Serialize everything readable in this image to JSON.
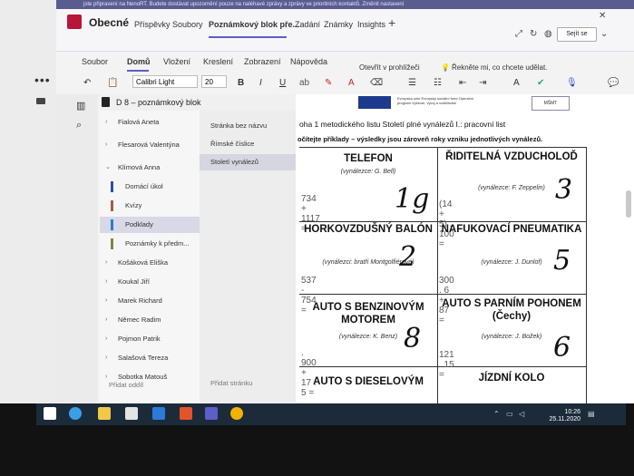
{
  "notice": "jste připravení na NenoRT. Budete dostávat upozornění pouze na naléhavé zprávy a zprávy ve prioritních kontaktů. Změnit nastavení",
  "teams": {
    "channel": "Obecné",
    "tabs": [
      "Příspěvky",
      "Soubory",
      "Poznámkový blok pře...",
      "Zadání",
      "Známky",
      "Insights"
    ],
    "plus": "+",
    "share_label": "Sejít se"
  },
  "ribbon": {
    "tabs": [
      "Soubor",
      "Domů",
      "Vložení",
      "Kreslení",
      "Zobrazení",
      "Nápověda"
    ],
    "open_browser": "Otevřít v prohlížeči",
    "tell_me": "Řekněte mi, co chcete udělat.",
    "font": "Calibri Light",
    "size": "20",
    "bold": "B",
    "italic": "I",
    "underline": "U"
  },
  "notebook": {
    "title": "D 8 – poznámkový blok",
    "sections": [
      {
        "label": "Fialová Aneta",
        "type": "group"
      },
      {
        "label": "Flesarová Valentýna",
        "type": "group"
      },
      {
        "label": "Klímová Anna",
        "type": "group-open"
      },
      {
        "label": "Domácí úkol",
        "type": "sub",
        "color": "#2b4ea8"
      },
      {
        "label": "Kvízy",
        "type": "sub",
        "color": "#a65a4a"
      },
      {
        "label": "Podklady",
        "type": "sub-selected",
        "color": "#2b7bd6"
      },
      {
        "label": "Poznámky k předm...",
        "type": "sub",
        "color": "#7a8a3a"
      },
      {
        "label": "Košáková Eliška",
        "type": "group"
      },
      {
        "label": "Koukal Jiří",
        "type": "group"
      },
      {
        "label": "Marek Richard",
        "type": "group"
      },
      {
        "label": "Němec Radim",
        "type": "group"
      },
      {
        "label": "Pojmon Patrik",
        "type": "group"
      },
      {
        "label": "Salašová Tereza",
        "type": "group"
      },
      {
        "label": "Sobotka Matouš",
        "type": "group"
      }
    ],
    "pages": [
      {
        "label": "Stránka bez názvu",
        "selected": false
      },
      {
        "label": "Římské číslice",
        "selected": false
      },
      {
        "label": "Století vynálezů",
        "selected": true
      }
    ],
    "add_section": "Přidat oddíl",
    "add_page": "Přidat stránku"
  },
  "page": {
    "eu_text": "Evropská unie Evropský sociální fond Operační program Výzkum, vývoj a vzdělávání",
    "msmt": "MŠMT",
    "heading": "oha 1 metodického listu Století plné vynálezů I.: pracovní list",
    "instruction": "očítejte příklady – výsledky jsou zároveň roky vzniku jednotlivých vynálezů.",
    "cells": [
      {
        "title": "TELEFON",
        "inventor": "(vynálezce: G. Bell)",
        "example": "734 + 1117 =",
        "answer": "1g"
      },
      {
        "title": "ŘIDITELNÁ VZDUCHOLOĎ",
        "inventor": "(vynálezce: F. Zeppelin)",
        "example": "(14 + 5) . 100 =",
        "answer": "3"
      },
      {
        "title": "HORKOVZDUŠNÝ BALÓN",
        "inventor": "(vynálezci: bratři Montgolfiérové)",
        "example": "537 - 754 =",
        "answer": "2"
      },
      {
        "title": "NAFUKOVACÍ PNEUMATIKA",
        "inventor": "(vynálezce: J. Dunlof)",
        "example": "300 . 6 + 87 =",
        "answer": "5"
      },
      {
        "title": "AUTO S BENZINOVÝM MOTOREM",
        "inventor": "(vynálezce: K. Benz)",
        "example": ". 900 + 17 . 5 =",
        "answer": "8"
      },
      {
        "title": "AUTO S PARNÍM POHONEM (Čechy)",
        "inventor": "(vynálezce: J. Božek)",
        "example": "121 . 15 =",
        "answer": "6"
      },
      {
        "title": "AUTO S DIESELOVÝM",
        "inventor": "",
        "example": "",
        "answer": ""
      },
      {
        "title": "JÍZDNÍ KOLO",
        "inventor": "",
        "example": "",
        "answer": ""
      }
    ]
  },
  "taskbar": {
    "time": "10:26",
    "date": "25.11.2020"
  }
}
